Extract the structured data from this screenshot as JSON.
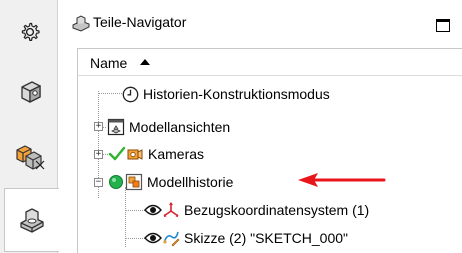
{
  "leftbar": {
    "buttons": [
      {
        "icon": "gear-icon"
      },
      {
        "icon": "part-cube-icon"
      },
      {
        "icon": "assembly-icon"
      },
      {
        "icon": "part-navigator-icon",
        "active": true
      }
    ]
  },
  "navigator": {
    "title": "Teile-Navigator",
    "column_header": "Name",
    "tree": [
      {
        "label": "Historien-Konstruktionsmodus",
        "icon": "clock-icon"
      },
      {
        "label": "Modellansichten",
        "icon": "model-views-icon",
        "expander": "+"
      },
      {
        "label": "Kameras",
        "icon": "camera-icon",
        "expander": "+",
        "status": "checkmark"
      },
      {
        "label": "Modellhistorie",
        "icon": "model-history-icon",
        "expander": "−",
        "status": "green-dot",
        "highlighted": true
      },
      {
        "label": "Bezugskoordinatensystem (1)",
        "icon": "datum-csys-icon",
        "visibility": "eye"
      },
      {
        "label": "Skizze (2) \"SKETCH_000\"",
        "icon": "sketch-icon",
        "visibility": "eye"
      }
    ]
  },
  "colors": {
    "annotation_arrow": "#e8151b",
    "check": "#2fb52f",
    "green_dot": "#22b14c"
  }
}
